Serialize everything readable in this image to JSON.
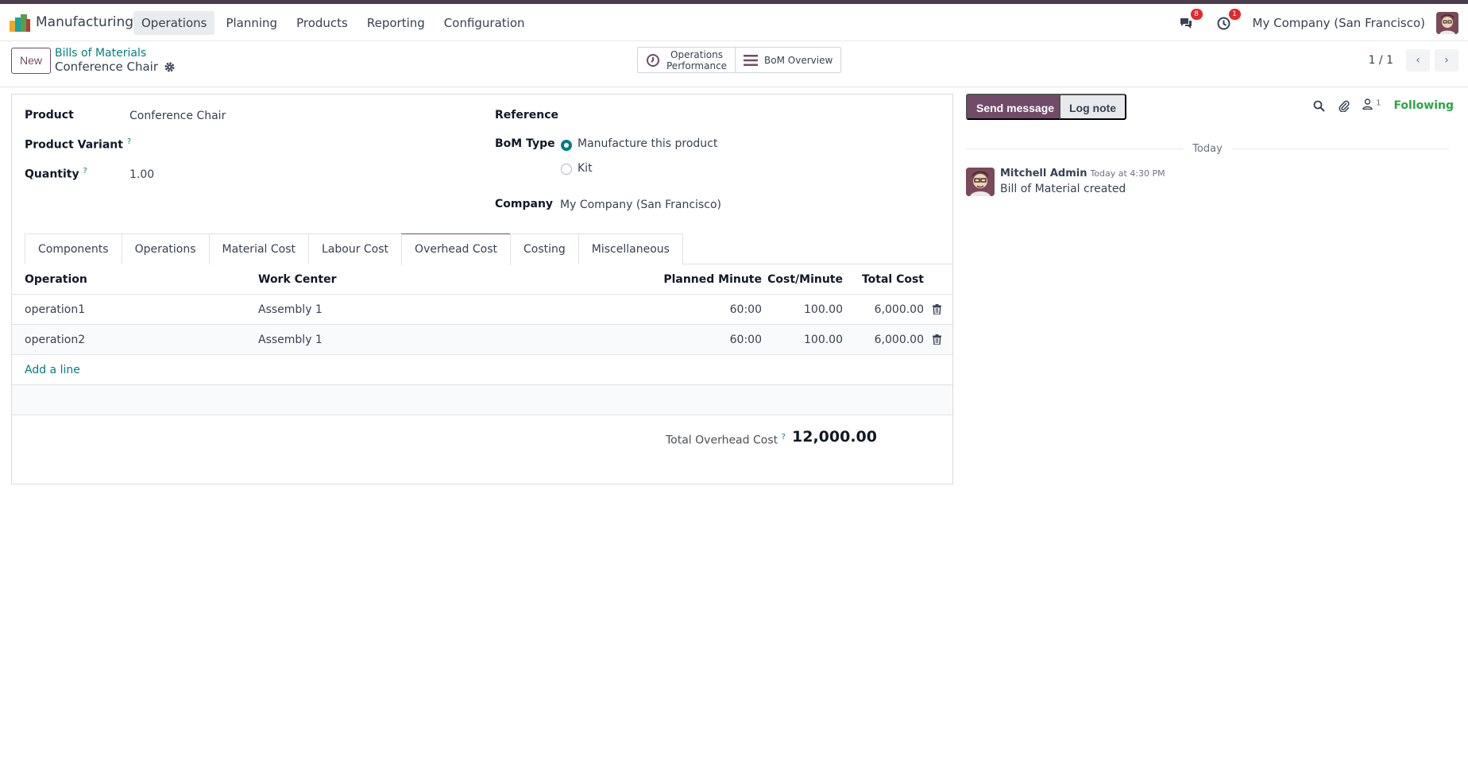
{
  "navbar": {
    "app_name": "Manufacturing",
    "menu": [
      "Operations",
      "Planning",
      "Products",
      "Reporting",
      "Configuration"
    ],
    "active_menu": "Operations",
    "messages_badge": "8",
    "activities_badge": "1",
    "company": "My Company (San Francisco)"
  },
  "control": {
    "new_label": "New",
    "breadcrumb_parent": "Bills of Materials",
    "breadcrumb_current": "Conference Chair",
    "smart_buttons": {
      "ops_perf_line1": "Operations",
      "ops_perf_line2": "Performance",
      "bom_overview": "BoM Overview"
    },
    "pager": "1 / 1"
  },
  "form": {
    "product_label": "Product",
    "product_value": "Conference Chair",
    "variant_label": "Product Variant",
    "quantity_label": "Quantity",
    "quantity_value": "1.00",
    "reference_label": "Reference",
    "bom_type_label": "BoM Type",
    "bom_type_options": [
      "Manufacture this product",
      "Kit"
    ],
    "bom_type_selected": "Manufacture this product",
    "company_label": "Company",
    "company_value": "My Company (San Francisco)",
    "help_mark": "?"
  },
  "tabs": [
    "Components",
    "Operations",
    "Material Cost",
    "Labour Cost",
    "Overhead Cost",
    "Costing",
    "Miscellaneous"
  ],
  "active_tab": "Overhead Cost",
  "table": {
    "headers": {
      "operation": "Operation",
      "work_center": "Work Center",
      "planned_minute": "Planned Minute",
      "cost_minute": "Cost/Minute",
      "total_cost": "Total Cost"
    },
    "rows": [
      {
        "operation": "operation1",
        "work_center": "Assembly 1",
        "planned_minute": "60:00",
        "cost_minute": "100.00",
        "total_cost": "6,000.00"
      },
      {
        "operation": "operation2",
        "work_center": "Assembly 1",
        "planned_minute": "60:00",
        "cost_minute": "100.00",
        "total_cost": "6,000.00"
      }
    ],
    "add_line": "Add a line"
  },
  "totals": {
    "label": "Total Overhead Cost",
    "value": "12,000.00"
  },
  "chatter": {
    "send_message": "Send message",
    "log_note": "Log note",
    "follower_count": "1",
    "following": "Following",
    "date_separator": "Today",
    "message": {
      "author": "Mitchell Admin",
      "time": "Today at 4:30 PM",
      "body": "Bill of Material created"
    }
  },
  "colors": {
    "brand": "#714b67",
    "accent": "#017e84",
    "following": "#28a745",
    "badge": "#e3282e"
  }
}
